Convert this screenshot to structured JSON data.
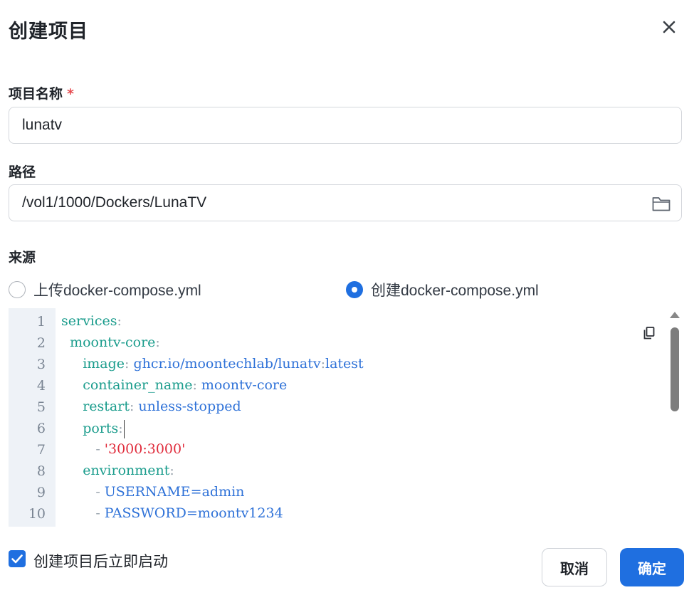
{
  "dialog": {
    "title": "创建项目",
    "close_icon": "close-icon"
  },
  "name_field": {
    "label": "项目名称",
    "required_mark": "*",
    "value": "lunatv"
  },
  "path_field": {
    "label": "路径",
    "value": "/vol1/1000/Dockers/LunaTV",
    "icon": "folder-icon"
  },
  "source": {
    "label": "来源",
    "options": [
      {
        "label": "上传docker-compose.yml",
        "selected": false
      },
      {
        "label": "创建docker-compose.yml",
        "selected": true
      }
    ]
  },
  "editor": {
    "line_numbers": [
      "1",
      "2",
      "3",
      "4",
      "5",
      "6",
      "7",
      "8",
      "9",
      "10"
    ],
    "lines": [
      [
        {
          "t": "services",
          "c": "k"
        },
        {
          "t": ":",
          "c": "p"
        }
      ],
      [
        {
          "t": "  ",
          "c": "p"
        },
        {
          "t": "moontv-core",
          "c": "k"
        },
        {
          "t": ":",
          "c": "p"
        }
      ],
      [
        {
          "t": "     ",
          "c": "p"
        },
        {
          "t": "image",
          "c": "k"
        },
        {
          "t": ": ",
          "c": "p"
        },
        {
          "t": "ghcr.io/moontechlab/lunatv",
          "c": "v"
        },
        {
          "t": ":",
          "c": "p"
        },
        {
          "t": "latest",
          "c": "v"
        }
      ],
      [
        {
          "t": "     ",
          "c": "p"
        },
        {
          "t": "container_name",
          "c": "k"
        },
        {
          "t": ": ",
          "c": "p"
        },
        {
          "t": "moontv-core",
          "c": "v"
        }
      ],
      [
        {
          "t": "     ",
          "c": "p"
        },
        {
          "t": "restart",
          "c": "k"
        },
        {
          "t": ": ",
          "c": "p"
        },
        {
          "t": "unless-stopped",
          "c": "v"
        }
      ],
      [
        {
          "t": "     ",
          "c": "p"
        },
        {
          "t": "ports",
          "c": "k"
        },
        {
          "t": ":",
          "c": "p"
        }
      ],
      [
        {
          "t": "        - ",
          "c": "p"
        },
        {
          "t": "'3000:3000'",
          "c": "s"
        }
      ],
      [
        {
          "t": "     ",
          "c": "p"
        },
        {
          "t": "environment",
          "c": "k"
        },
        {
          "t": ":",
          "c": "p"
        }
      ],
      [
        {
          "t": "        - ",
          "c": "p"
        },
        {
          "t": "USERNAME=admin",
          "c": "v"
        }
      ],
      [
        {
          "t": "        - ",
          "c": "p"
        },
        {
          "t": "PASSWORD=moontv1234",
          "c": "v"
        }
      ]
    ],
    "copy_icon": "copy-icon"
  },
  "autostart": {
    "label": "创建项目后立即启动",
    "checked": true
  },
  "actions": {
    "cancel_label": "取消",
    "confirm_label": "确定"
  },
  "colors": {
    "accent": "#1f6fe0",
    "yaml_key": "#1a9c8c",
    "yaml_value": "#2f72d8",
    "yaml_string": "#e02c3c",
    "required": "#e5484d"
  }
}
